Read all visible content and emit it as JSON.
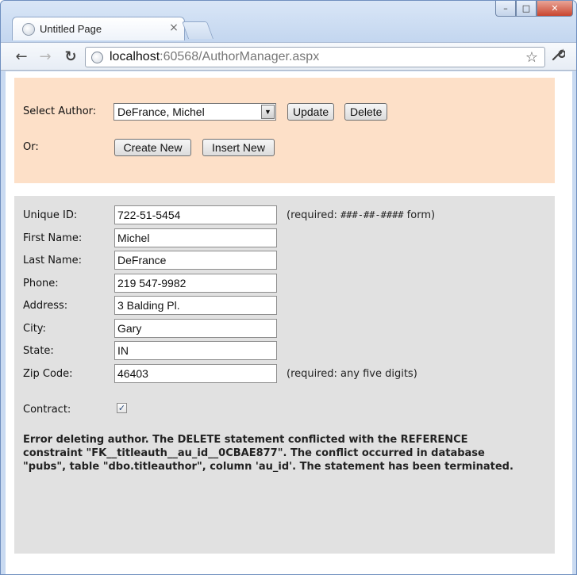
{
  "browser": {
    "tab_title": "Untitled Page",
    "tab_close": "×",
    "url_host": "localhost",
    "url_rest": ":60568/AuthorManager.aspx",
    "window_buttons": {
      "minimize": "–",
      "maximize": "□",
      "close": "✕"
    },
    "nav": {
      "back": "←",
      "forward": "→",
      "reload": "↻",
      "star": "☆",
      "wrench": "🔧"
    }
  },
  "selector_panel": {
    "select_author_label": "Select Author:",
    "selected_author": "DeFrance, Michel",
    "update_label": "Update",
    "delete_label": "Delete",
    "or_label": "Or:",
    "create_new_label": "Create New",
    "insert_new_label": "Insert New",
    "background_color": "#fde0c8"
  },
  "form": {
    "fields": [
      {
        "label": "Unique ID:",
        "value": "722-51-5454"
      },
      {
        "label": "First Name:",
        "value": "Michel"
      },
      {
        "label": "Last Name:",
        "value": "DeFrance"
      },
      {
        "label": "Phone:",
        "value": "219 547-9982"
      },
      {
        "label": "Address:",
        "value": "3 Balding Pl."
      },
      {
        "label": "City:",
        "value": "Gary"
      },
      {
        "label": "State:",
        "value": "IN"
      },
      {
        "label": "Zip Code:",
        "value": "46403"
      }
    ],
    "id_hint_prefix": "(required: ",
    "id_hint_pattern": "###-##-####",
    "id_hint_suffix": " form)",
    "zip_hint": "(required: any five digits)",
    "contract_label": "Contract:",
    "contract_checked": true,
    "background_color": "#e1e1e1"
  },
  "error_message": "Error deleting author. The DELETE statement conflicted with the REFERENCE constraint \"FK__titleauth__au_id__0CBAE877\". The conflict occurred in database \"pubs\", table \"dbo.titleauthor\", column 'au_id'. The statement has been terminated."
}
